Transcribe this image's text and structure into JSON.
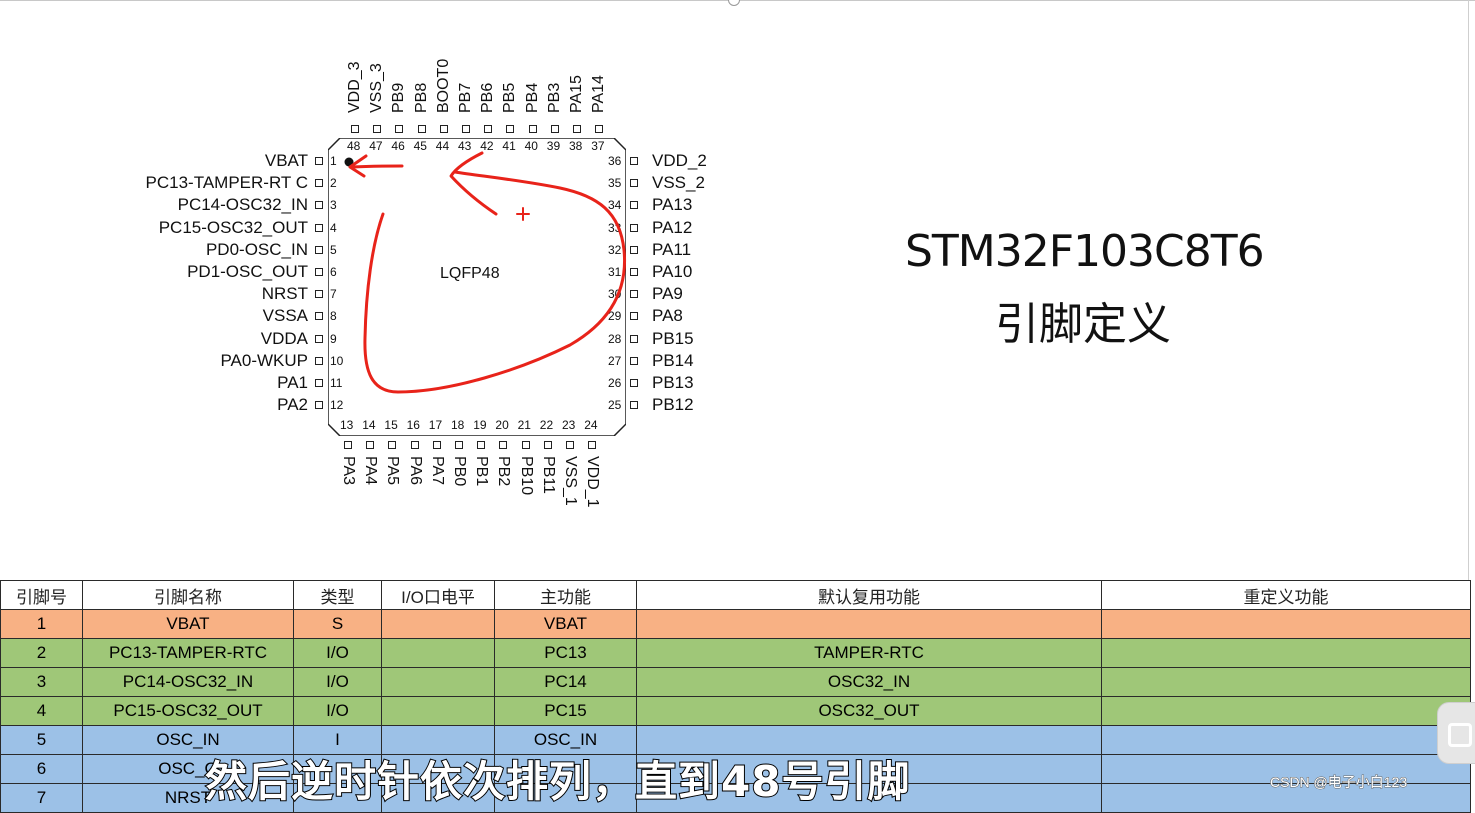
{
  "title": {
    "line1": "STM32F103C8T6",
    "line2": "引脚定义"
  },
  "package": "LQFP48",
  "pins": {
    "left": [
      {
        "num": "1",
        "name": "VBAT"
      },
      {
        "num": "2",
        "name": "PC13-TAMPER-RT C"
      },
      {
        "num": "3",
        "name": "PC14-OSC32_IN"
      },
      {
        "num": "4",
        "name": "PC15-OSC32_OUT"
      },
      {
        "num": "5",
        "name": "PD0-OSC_IN"
      },
      {
        "num": "6",
        "name": "PD1-OSC_OUT"
      },
      {
        "num": "7",
        "name": "NRST"
      },
      {
        "num": "8",
        "name": "VSSA"
      },
      {
        "num": "9",
        "name": "VDDA"
      },
      {
        "num": "10",
        "name": "PA0-WKUP"
      },
      {
        "num": "11",
        "name": "PA1"
      },
      {
        "num": "12",
        "name": "PA2"
      }
    ],
    "bottom": [
      {
        "num": "13",
        "name": "PA3"
      },
      {
        "num": "14",
        "name": "PA4"
      },
      {
        "num": "15",
        "name": "PA5"
      },
      {
        "num": "16",
        "name": "PA6"
      },
      {
        "num": "17",
        "name": "PA7"
      },
      {
        "num": "18",
        "name": "PB0"
      },
      {
        "num": "19",
        "name": "PB1"
      },
      {
        "num": "20",
        "name": "PB2"
      },
      {
        "num": "21",
        "name": "PB10"
      },
      {
        "num": "22",
        "name": "PB11"
      },
      {
        "num": "23",
        "name": "VSS_1"
      },
      {
        "num": "24",
        "name": "VDD_1"
      }
    ],
    "right": [
      {
        "num": "36",
        "name": "VDD_2"
      },
      {
        "num": "35",
        "name": "VSS_2"
      },
      {
        "num": "34",
        "name": "PA13"
      },
      {
        "num": "33",
        "name": "PA12"
      },
      {
        "num": "32",
        "name": "PA11"
      },
      {
        "num": "31",
        "name": "PA10"
      },
      {
        "num": "30",
        "name": "PA9"
      },
      {
        "num": "29",
        "name": "PA8"
      },
      {
        "num": "28",
        "name": "PB15"
      },
      {
        "num": "27",
        "name": "PB14"
      },
      {
        "num": "26",
        "name": "PB13"
      },
      {
        "num": "25",
        "name": "PB12"
      }
    ],
    "top": [
      {
        "num": "48",
        "name": "VDD_3"
      },
      {
        "num": "47",
        "name": "VSS_3"
      },
      {
        "num": "46",
        "name": "PB9"
      },
      {
        "num": "45",
        "name": "PB8"
      },
      {
        "num": "44",
        "name": "BOOT0"
      },
      {
        "num": "43",
        "name": "PB7"
      },
      {
        "num": "42",
        "name": "PB6"
      },
      {
        "num": "41",
        "name": "PB5"
      },
      {
        "num": "40",
        "name": "PB4"
      },
      {
        "num": "39",
        "name": "PB3"
      },
      {
        "num": "38",
        "name": "PA15"
      },
      {
        "num": "37",
        "name": "PA14"
      }
    ]
  },
  "table": {
    "headers": [
      "引脚号",
      "引脚名称",
      "类型",
      "I/O口电平",
      "主功能",
      "默认复用功能",
      "重定义功能"
    ],
    "rows": [
      {
        "color": "orange",
        "cells": [
          "1",
          "VBAT",
          "S",
          "",
          "VBAT",
          "",
          ""
        ]
      },
      {
        "color": "green",
        "cells": [
          "2",
          "PC13-TAMPER-RTC",
          "I/O",
          "",
          "PC13",
          "TAMPER-RTC",
          ""
        ]
      },
      {
        "color": "green",
        "cells": [
          "3",
          "PC14-OSC32_IN",
          "I/O",
          "",
          "PC14",
          "OSC32_IN",
          ""
        ]
      },
      {
        "color": "green",
        "cells": [
          "4",
          "PC15-OSC32_OUT",
          "I/O",
          "",
          "PC15",
          "OSC32_OUT",
          ""
        ]
      },
      {
        "color": "blue",
        "cells": [
          "5",
          "OSC_IN",
          "I",
          "",
          "OSC_IN",
          "",
          ""
        ]
      },
      {
        "color": "blue",
        "cells": [
          "6",
          "OSC_O",
          "",
          "",
          "",
          "",
          ""
        ]
      },
      {
        "color": "blue",
        "cells": [
          "7",
          "NRST",
          "",
          "",
          "",
          "",
          ""
        ]
      }
    ]
  },
  "subtitle": "然后逆时针依次排列，直到48号引脚",
  "watermark": "CSDN @电子小白123",
  "colors": {
    "annotation": "#e8231a",
    "orange": "#f8b184",
    "green": "#9fc778",
    "blue": "#9cc1e7"
  }
}
